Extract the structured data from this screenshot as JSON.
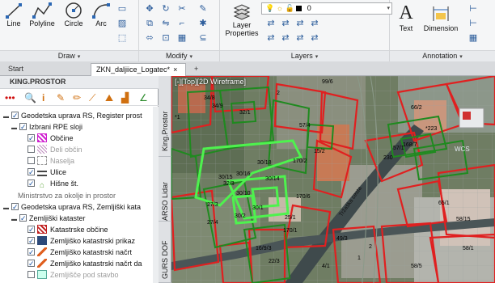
{
  "ribbon": {
    "draw": {
      "label": "Draw",
      "tools": [
        "Line",
        "Polyline",
        "Circle",
        "Arc"
      ]
    },
    "modify": {
      "label": "Modify"
    },
    "layers": {
      "label": "Layers",
      "layer_properties": "Layer\nProperties",
      "layer_properties_line1": "Layer",
      "layer_properties_line2": "Properties",
      "current_layer": "0"
    },
    "annotation": {
      "label": "Annotation",
      "text_tool": "Text",
      "dimension_tool": "Dimension"
    }
  },
  "tabs": [
    {
      "label": "Start"
    },
    {
      "label": "ZKN_daljiice_Logatec*"
    }
  ],
  "left_panel": {
    "title": "KING.PROSTOR",
    "tree": [
      {
        "label": "Geodetska uprava RS, Register prost",
        "checked": true,
        "expanded": true
      },
      {
        "label": "Izbrani RPE sloji",
        "checked": true,
        "expanded": true
      },
      {
        "label": "Občine",
        "checked": true
      },
      {
        "label": "Deli občin",
        "checked": false
      },
      {
        "label": "Naselja",
        "checked": false
      },
      {
        "label": "Ulice",
        "checked": true
      },
      {
        "label": "Hišne št.",
        "checked": true
      },
      {
        "label": "Ministrstvo za okolje in prostor",
        "checked": false
      },
      {
        "label": "Geodetska uprava RS, Zemljiški kata",
        "checked": true,
        "expanded": true
      },
      {
        "label": "Zemljiški kataster",
        "checked": true,
        "expanded": true
      },
      {
        "label": "Katastrske občine",
        "checked": true
      },
      {
        "label": "Zemljiško katastrski prikaz",
        "checked": true
      },
      {
        "label": "Zemljiško katastrski načrt",
        "checked": true
      },
      {
        "label": "Zemljiško katastrski načrt da",
        "checked": true
      },
      {
        "label": "Zemljišče pod stavbo",
        "checked": false
      }
    ]
  },
  "side_tabs": [
    "King.Prostor",
    "ARSO Lidar",
    "GURS DOF"
  ],
  "map": {
    "view_label": "[-][Top][2D Wireframe]",
    "wcs": "WCS",
    "street": "Tržaška cesta",
    "parcels": [
      "34/8",
      "34/9",
      "32/1",
      "2",
      "57/4",
      "99/6",
      "66/2",
      "57/1",
      "15/2",
      "*223",
      "168/7",
      "230",
      "*1",
      "30/18",
      "170/2",
      "30/16",
      "30/15",
      "30/14",
      "30/10",
      "30/2",
      "30/1",
      "27/3",
      "27/4",
      "170/6",
      "25/1",
      "65/1",
      "49/3",
      "58/15",
      "170/1",
      "16/9/3",
      "22/3",
      "4/1",
      "2",
      "32/3",
      "58/5",
      "58/1",
      "1"
    ],
    "colors": {
      "red": "#e02020",
      "green": "#1f8a1f",
      "lime": "#4ef24e",
      "road": "#3f4a4c"
    }
  }
}
